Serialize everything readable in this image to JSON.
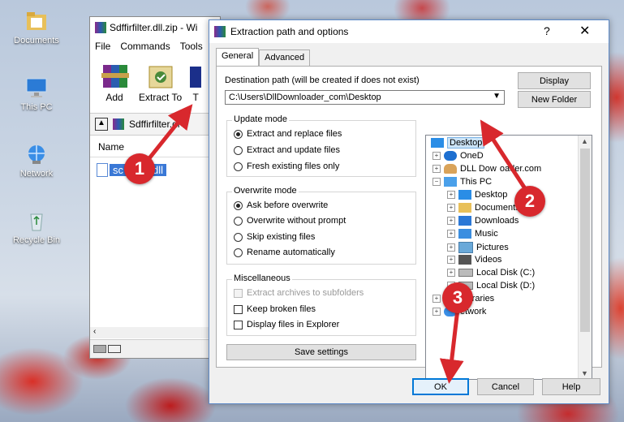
{
  "desktop": {
    "icons": [
      {
        "label": "Documents",
        "icon": "folder-documents-icon"
      },
      {
        "label": "This PC",
        "icon": "computer-icon"
      },
      {
        "label": "Network",
        "icon": "network-icon"
      },
      {
        "label": "Recycle Bin",
        "icon": "recycle-bin-icon"
      }
    ]
  },
  "winrar": {
    "title": "Sdffirfilter.dll.zip - Wi",
    "menu": [
      "File",
      "Commands",
      "Tools"
    ],
    "toolbar": {
      "add": "Add",
      "extract": "Extract To",
      "partial": "T"
    },
    "path": "Sdffirfilter.dl",
    "list_header": "Name",
    "file_prefix": "sc",
    "file_suffix": "dll"
  },
  "dialog": {
    "title": "Extraction path and options",
    "help": "?",
    "close": "✕",
    "tabs": {
      "general": "General",
      "advanced": "Advanced"
    },
    "dest_label": "Destination path (will be created if does not exist)",
    "dest_value": "C:\\Users\\DllDownloader_com\\Desktop",
    "buttons": {
      "display": "Display",
      "new_folder": "New Folder",
      "save": "Save settings",
      "ok": "OK",
      "cancel": "Cancel",
      "help": "Help"
    },
    "update_mode": {
      "title": "Update mode",
      "options": [
        "Extract and replace files",
        "Extract and update files",
        "Fresh existing files only"
      ],
      "selected": 0
    },
    "overwrite_mode": {
      "title": "Overwrite mode",
      "options": [
        "Ask before overwrite",
        "Overwrite without prompt",
        "Skip existing files",
        "Rename automatically"
      ],
      "selected": 0
    },
    "misc": {
      "title": "Miscellaneous",
      "options": [
        "Extract archives to subfolders",
        "Keep broken files",
        "Display files in Explorer"
      ]
    },
    "tree": [
      {
        "label": "Desktop",
        "selected": true
      },
      {
        "label": "OneD"
      },
      {
        "label": "DLL Dow"
      },
      {
        "label": "oader.com"
      },
      {
        "label": "This PC"
      },
      {
        "label": "Desktop"
      },
      {
        "label": "Documents"
      },
      {
        "label": "Downloads"
      },
      {
        "label": "Music"
      },
      {
        "label": "Pictures"
      },
      {
        "label": "Videos"
      },
      {
        "label": "Local Disk (C:)"
      },
      {
        "label": "Local Disk (D:)"
      },
      {
        "label": "Libraries"
      },
      {
        "label": "etwork"
      }
    ]
  },
  "annotations": [
    "1",
    "2",
    "3"
  ],
  "colors": {
    "marker": "#d8282d",
    "selection": "#3a78d6",
    "ok_border": "#0078d7"
  }
}
